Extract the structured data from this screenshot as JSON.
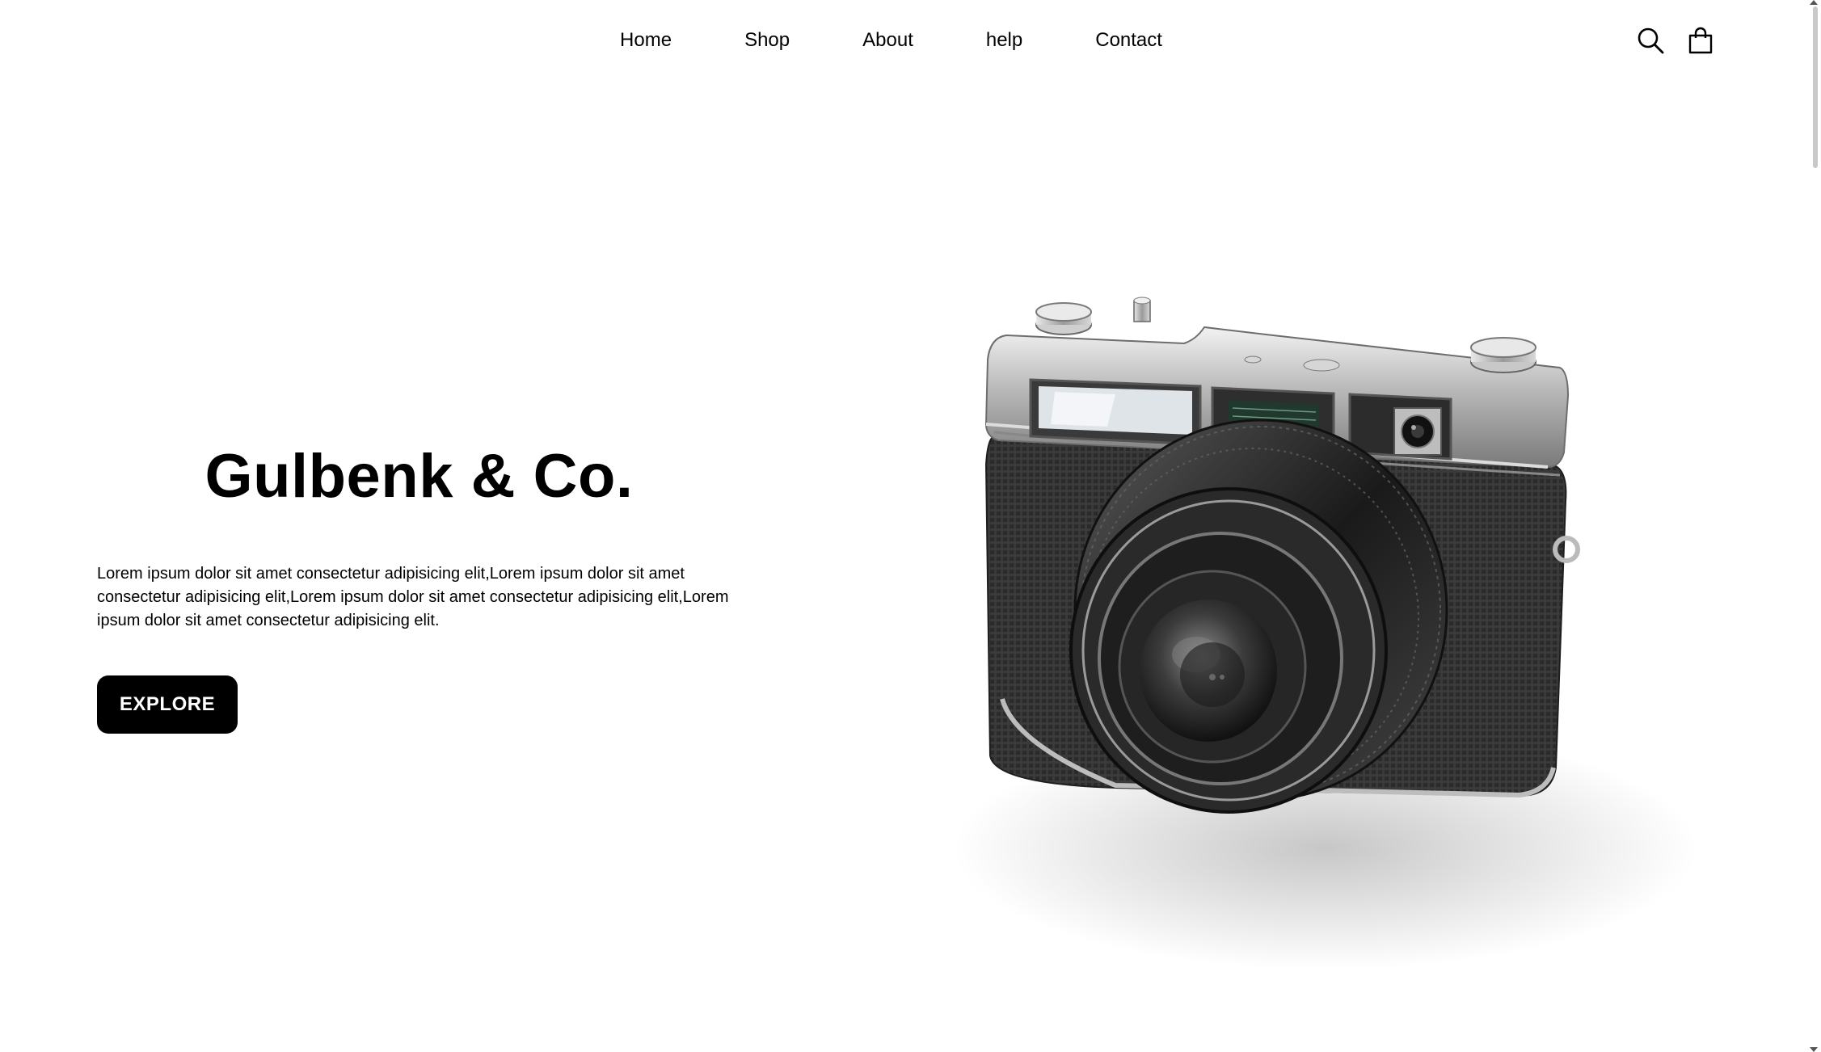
{
  "nav": {
    "links": [
      "Home",
      "Shop",
      "About",
      "help",
      "Contact"
    ],
    "icons": [
      "search-icon",
      "shopping-bag-icon"
    ]
  },
  "hero": {
    "title": "Gulbenk & Co.",
    "description": "Lorem ipsum dolor sit amet consectetur adipisicing elit,Lorem ipsum dolor sit amet consectetur adipisicing elit,Lorem ipsum dolor sit amet consectetur adipisicing elit,Lorem ipsum dolor sit amet consectetur adipisicing elit.",
    "button_label": "EXPLORE",
    "image": "camera-image"
  },
  "colors": {
    "background": "#ffffff",
    "text": "#000000",
    "button_bg": "#000000",
    "button_text": "#ffffff"
  }
}
